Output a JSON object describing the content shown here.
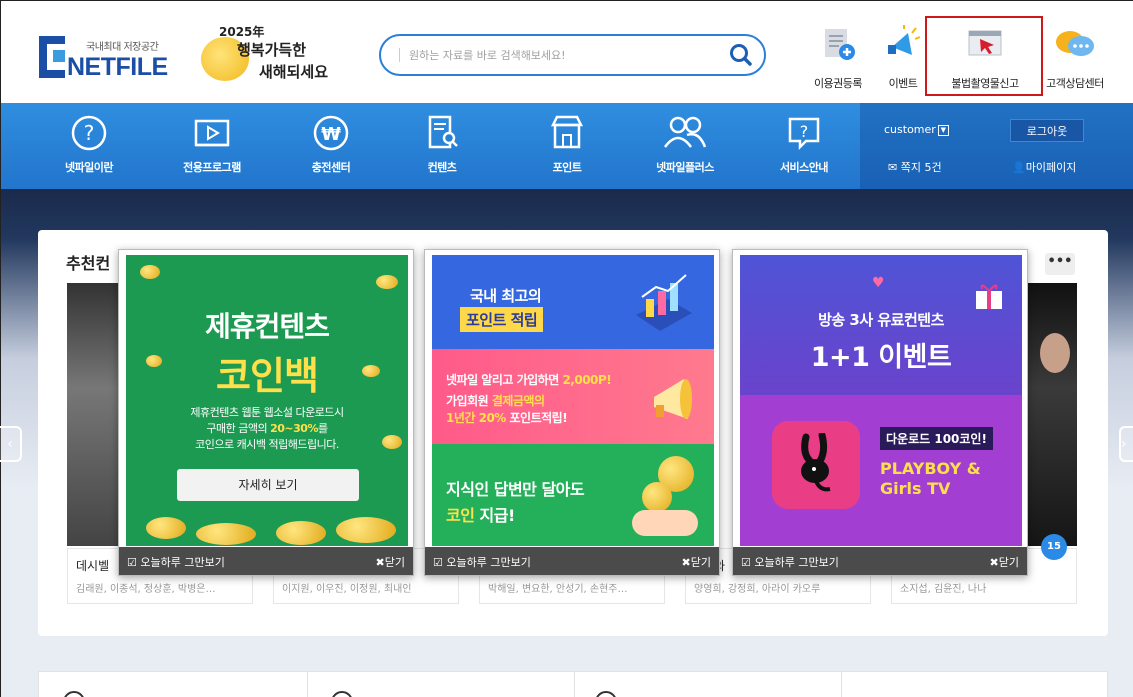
{
  "header": {
    "logo_tagline": "국내최대 저장공간",
    "logo_name": "NETFILE",
    "newyear_line1": "2025年",
    "newyear_line2": "행복가득한",
    "newyear_line3": "새해되세요",
    "search_placeholder": "원하는 자료를 바로 검색해보세요!",
    "links": [
      {
        "label": "이용권등록",
        "icon": "ticket-add-icon"
      },
      {
        "label": "이벤트",
        "icon": "megaphone-icon"
      },
      {
        "label": "불법촬영물신고",
        "icon": "report-icon"
      },
      {
        "label": "고객상담센터",
        "icon": "chat-bubbles-icon"
      }
    ],
    "report_highlight_color": "#d01818"
  },
  "nav": {
    "items": [
      {
        "label": "넷파일이란",
        "icon": "question-circle-icon"
      },
      {
        "label": "전용프로그램",
        "icon": "play-window-icon"
      },
      {
        "label": "충전센터",
        "icon": "won-coin-icon"
      },
      {
        "label": "컨텐츠",
        "icon": "document-search-icon"
      },
      {
        "label": "포인트",
        "icon": "shop-icon"
      },
      {
        "label": "넷파일플러스",
        "icon": "users-icon"
      },
      {
        "label": "서비스안내",
        "icon": "help-bubble-icon"
      }
    ],
    "username": "customer",
    "logout": "로그아웃",
    "messages": "쪽지 5건",
    "mypage": "마이페이지",
    "accent": "#2a82d8"
  },
  "recommend": {
    "title": "추천컨",
    "more": "•••",
    "badge": "15",
    "cards": [
      {
        "title": "데시벨",
        "cast": "김래원, 이종석, 정상훈, 박병은…"
      },
      {
        "title": "",
        "cast": "이지원, 이우진, 이정원, 최내인"
      },
      {
        "title": "",
        "cast": "박해일, 변요한, 안성기, 손현주…"
      },
      {
        "title": "와",
        "cast": "양영희, 강정희, 아라이 카오루"
      },
      {
        "title": "",
        "cast": "소지섭, 김윤진, 나나"
      }
    ]
  },
  "popups": [
    {
      "line1": "제휴컨텐츠",
      "line2": "코인백",
      "desc1": "제휴컨텐츠 웹툰 웹소설 다운로드시",
      "desc2a": "구매한 금액의 ",
      "desc2b": "20~30%",
      "desc2c": "를",
      "desc3": "코인으로 캐시백 적립해드립니다.",
      "button": "자세히 보기",
      "no_today": "오늘하루 그만보기",
      "close": "닫기"
    },
    {
      "s1a": "국내 최고의",
      "s1b": "포인트 적립",
      "s2a1": "넷파일 알리고 가입하면 ",
      "s2a2": "2,000P!",
      "s2b1": "가입회원 ",
      "s2b2": "결제금액의",
      "s2c1": "1년간 20%",
      "s2c2": " 포인트적립!",
      "s3a": "지식인 답변만 달아도",
      "s3b1": "코인",
      "s3b2": " 지급!",
      "no_today": "오늘하루 그만보기",
      "close": "닫기"
    },
    {
      "s1a": "방송 3사 유료컨텐츠",
      "s1b": "1+1 이벤트",
      "tag": "다운로드 100코인!",
      "s2a": "PLAYBOY &",
      "s2b": "Girls TV",
      "no_today": "오늘하루 그만보기",
      "close": "닫기"
    }
  ]
}
